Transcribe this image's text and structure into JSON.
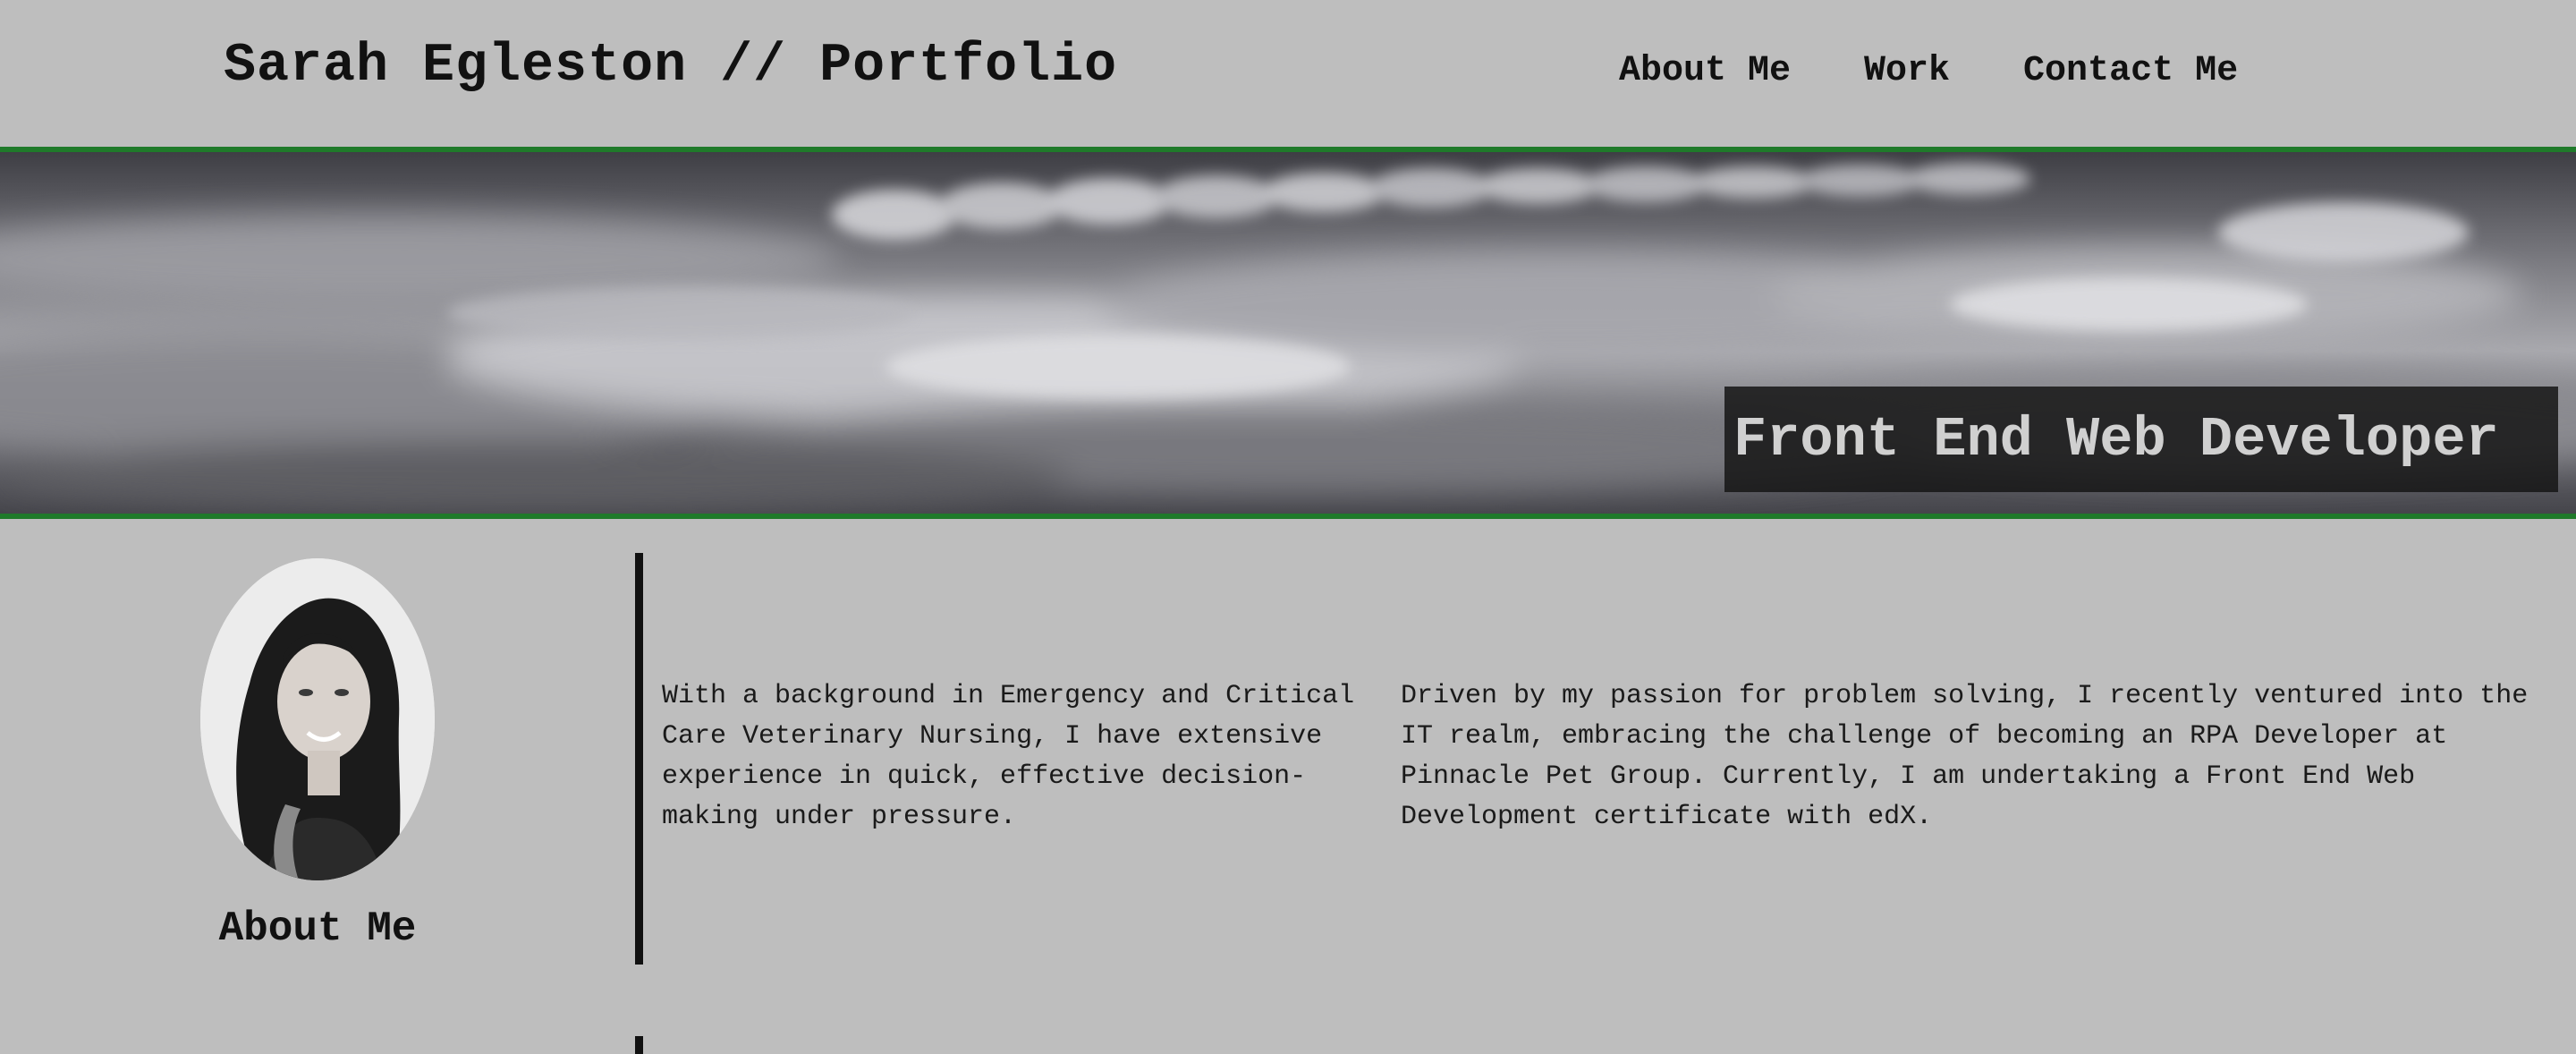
{
  "header": {
    "site_title": "Sarah Egleston // Portfolio",
    "nav": [
      {
        "label": "About Me"
      },
      {
        "label": "Work"
      },
      {
        "label": "Contact Me"
      }
    ]
  },
  "hero": {
    "tagline": "Front End Web Developer",
    "accent_color": "#1f7a2a"
  },
  "about": {
    "heading": "About Me",
    "paragraphs": [
      "With a background in Emergency and Critical Care Veterinary Nursing, I have extensive experience in quick, effective decision-making under pressure.",
      "Driven by my passion for problem solving, I recently ventured into the IT realm, embracing the challenge of becoming an RPA Developer at Pinnacle Pet Group. Currently, I am undertaking a Front End Web Development certificate with edX."
    ]
  }
}
